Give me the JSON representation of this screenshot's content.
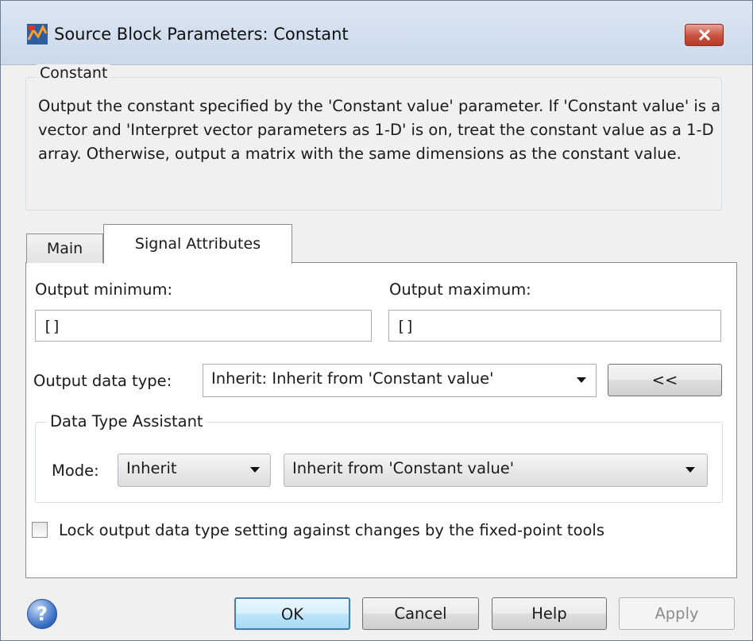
{
  "window": {
    "title": "Source Block Parameters: Constant",
    "close_label": "✕"
  },
  "description": {
    "group_title": "Constant",
    "text": "Output the constant specified by the 'Constant value' parameter. If 'Constant value' is a vector and 'Interpret vector parameters as 1-D' is on, treat the constant value as a 1-D array. Otherwise, output a matrix with the same dimensions as the constant value."
  },
  "tabs": [
    {
      "label": "Main",
      "active": false
    },
    {
      "label": "Signal Attributes",
      "active": true
    }
  ],
  "signal_attributes": {
    "output_min_label": "Output minimum:",
    "output_min_value": "[]",
    "output_max_label": "Output maximum:",
    "output_max_value": "[]",
    "data_type_label": "Output data type:",
    "data_type_value": "Inherit: Inherit from 'Constant value'",
    "assistant_button": "<<",
    "assistant": {
      "title": "Data Type Assistant",
      "mode_label": "Mode:",
      "mode_value": "Inherit",
      "inherit_value": "Inherit from 'Constant value'"
    },
    "lock_checkbox_label": "Lock output data type setting against changes by the fixed-point tools",
    "lock_checked": false
  },
  "footer": {
    "help_icon": "?",
    "ok": "OK",
    "cancel": "Cancel",
    "help": "Help",
    "apply": "Apply"
  },
  "colors": {
    "titlebar": "#cbd9ea",
    "close_button": "#c7523f",
    "ok_border": "#3c7fb1",
    "disabled_text": "#8d8d8d"
  },
  "icons": [
    "simulink-app-icon",
    "close-icon",
    "help-icon",
    "chevron-down-icon",
    "checkbox-icon"
  ]
}
